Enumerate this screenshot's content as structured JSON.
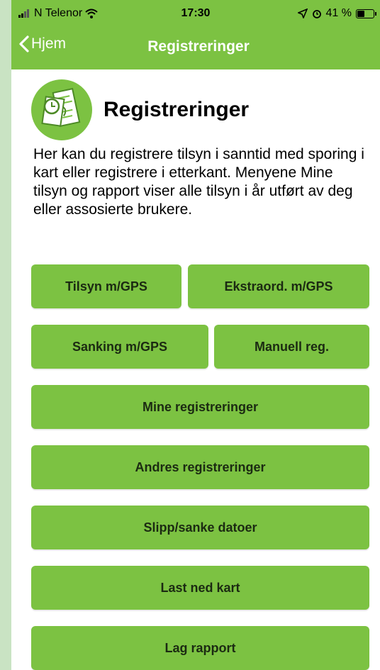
{
  "status_bar": {
    "carrier": "N Telenor",
    "time": "17:30",
    "battery_text": "41 %",
    "battery_level": 0.41
  },
  "nav": {
    "back_label": "Hjem",
    "title": "Registreringer"
  },
  "header": {
    "title": "Registreringer"
  },
  "intro_text": "Her kan du registrere tilsyn i sanntid med sporing i kart eller registrere i etterkant. Menyene Mine tilsyn og rapport viser alle tilsyn i år utført av deg eller assosierte brukere.",
  "buttons": {
    "tilsyn_gps": "Tilsyn m/GPS",
    "ekstraord_gps": "Ekstraord. m/GPS",
    "sanking_gps": "Sanking m/GPS",
    "manuell_reg": "Manuell reg.",
    "mine_reg": "Mine registreringer",
    "andres_reg": "Andres registreringer",
    "slipp_sanke": "Slipp/sanke datoer",
    "last_ned_kart": "Last ned kart",
    "lag_rapport": "Lag rapport"
  },
  "colors": {
    "brand_green": "#7cc242",
    "side_background": "#c9e3c3"
  }
}
